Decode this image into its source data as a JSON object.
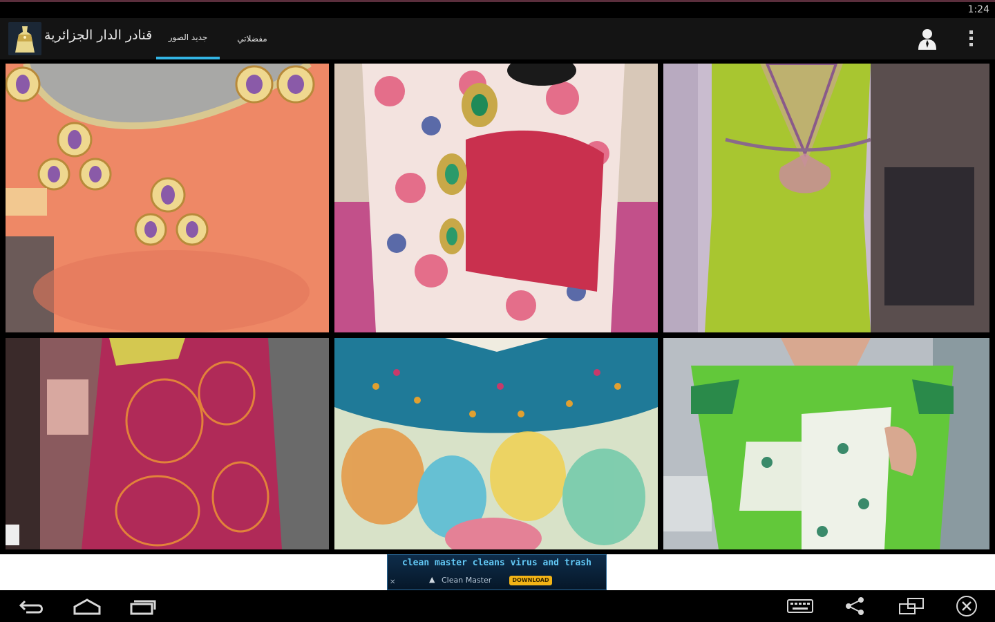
{
  "status_bar": {
    "time": "1:24"
  },
  "action_bar": {
    "app_title": "قنادر الدار الجزائرية",
    "tabs": [
      {
        "label": "جديد الصور",
        "selected": true
      },
      {
        "label": "مفضلاتي",
        "selected": false
      }
    ],
    "icons": [
      "app-logo-icon",
      "profile-icon",
      "overflow-menu-icon"
    ]
  },
  "gallery": {
    "items": [
      {
        "subject": "orange dress with beaded neckline"
      },
      {
        "subject": "floral print dress with red sash"
      },
      {
        "subject": "lime green dress with embroidered back"
      },
      {
        "subject": "pink patterned dress"
      },
      {
        "subject": "tie-dye dress with teal embroidered yoke"
      },
      {
        "subject": "green dress with floral panels"
      }
    ]
  },
  "ad_banner": {
    "headline": "clean master cleans virus and trash",
    "brand": "Clean Master",
    "button": "DOWNLOAD",
    "accent_color": "#f3b416"
  },
  "nav_bar": {
    "icons": [
      "back-icon",
      "home-icon",
      "recent-apps-icon",
      "keyboard-icon",
      "share-icon",
      "screen-rotate-icon",
      "close-icon"
    ]
  },
  "colors": {
    "tab_indicator": "#33b5e5",
    "action_bar": "#141414"
  }
}
